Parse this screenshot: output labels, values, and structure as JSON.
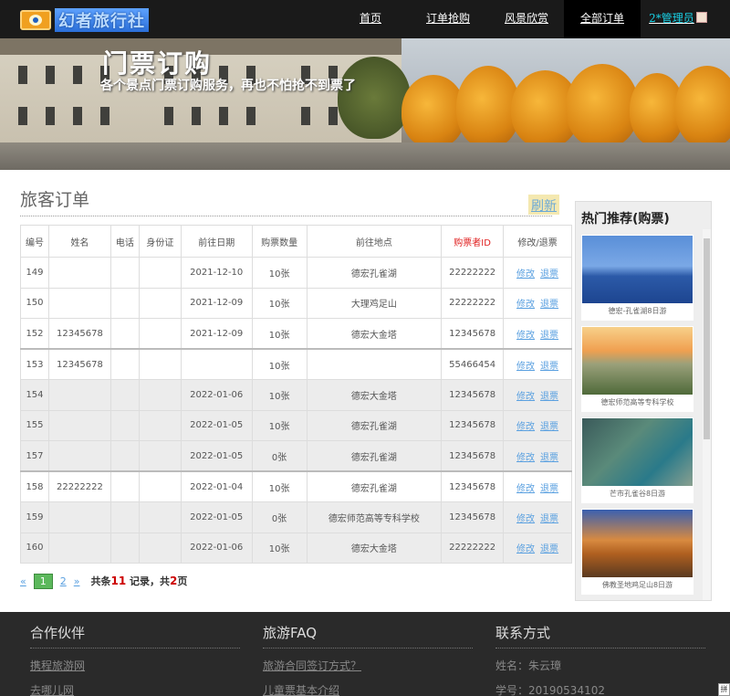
{
  "nav": {
    "logo_text": "幻者旅行社",
    "items": [
      {
        "label": "首页"
      },
      {
        "label": "订单抢购"
      },
      {
        "label": "风景欣赏"
      },
      {
        "label": "全部订单"
      }
    ],
    "admin_label": "2*管理员"
  },
  "banner": {
    "title": "门票订购",
    "subtitle": "各个景点门票订购服务，再也不怕抢不到票了"
  },
  "main": {
    "page_title": "旅客订单",
    "refresh_label": "刷新",
    "table": {
      "headers": [
        "编号",
        "姓名",
        "电话",
        "身份证",
        "前往日期",
        "购票数量",
        "前往地点",
        "购票者ID",
        "修改/退票"
      ],
      "edit_label": "修改",
      "refund_label": "退票",
      "rows": [
        {
          "id": "149",
          "name": "",
          "phone": "",
          "idcard": "",
          "date": "2021-12-10",
          "qty": "10张",
          "place": "德宏孔雀湖",
          "uid": "22222222"
        },
        {
          "id": "150",
          "name": "",
          "phone": "",
          "idcard": "",
          "date": "2021-12-09",
          "qty": "10张",
          "place": "大理鸡足山",
          "uid": "22222222"
        },
        {
          "id": "152",
          "name": "12345678",
          "phone": "",
          "idcard": "",
          "date": "2021-12-09",
          "qty": "10张",
          "place": "德宏大金塔",
          "uid": "12345678"
        },
        {
          "id": "153",
          "name": "12345678",
          "phone": "",
          "idcard": "",
          "date": "",
          "qty": "10张",
          "place": "",
          "uid": "55466454"
        },
        {
          "id": "154",
          "name": "",
          "phone": "",
          "idcard": "",
          "date": "2022-01-06",
          "qty": "10张",
          "place": "德宏大金塔",
          "uid": "12345678"
        },
        {
          "id": "155",
          "name": "",
          "phone": "",
          "idcard": "",
          "date": "2022-01-05",
          "qty": "10张",
          "place": "德宏孔雀湖",
          "uid": "12345678"
        },
        {
          "id": "157",
          "name": "",
          "phone": "",
          "idcard": "",
          "date": "2022-01-05",
          "qty": "0张",
          "place": "德宏孔雀湖",
          "uid": "12345678"
        },
        {
          "id": "158",
          "name": "22222222",
          "phone": "",
          "idcard": "",
          "date": "2022-01-04",
          "qty": "10张",
          "place": "德宏孔雀湖",
          "uid": "12345678"
        },
        {
          "id": "159",
          "name": "",
          "phone": "",
          "idcard": "",
          "date": "2022-01-05",
          "qty": "0张",
          "place": "德宏师范高等专科学校",
          "uid": "12345678"
        },
        {
          "id": "160",
          "name": "",
          "phone": "",
          "idcard": "",
          "date": "2022-01-06",
          "qty": "10张",
          "place": "德宏大金塔",
          "uid": "22222222"
        }
      ]
    },
    "pager": {
      "prev": "«",
      "pages": [
        "1",
        "2"
      ],
      "current": "1",
      "next": "»",
      "summary_prefix": "共条",
      "total_records": "11",
      "summary_mid": "记录，共",
      "total_pages": "2",
      "summary_suffix": "页"
    }
  },
  "sidebar": {
    "title": "热门推荐(购票)",
    "cards": [
      {
        "caption": "德宏-孔雀湖8日游",
        "image": "lake-photo"
      },
      {
        "caption": "德宏师范高等专科学校",
        "image": "campus-photo"
      },
      {
        "caption": "芒市孔雀谷8日游",
        "image": "peacock-photo"
      },
      {
        "caption": "佛教圣地鸡足山8日游",
        "image": "temple-photo"
      }
    ]
  },
  "footer": {
    "partners": {
      "title": "合作伙伴",
      "links": [
        "携程旅游网",
        "去哪儿网"
      ]
    },
    "faq": {
      "title": "旅游FAQ",
      "links": [
        "旅游合同签订方式？",
        "儿童票基本介绍"
      ]
    },
    "contact": {
      "title": "联系方式",
      "lines": [
        "姓名：朱云璋",
        "学号：20190534102"
      ]
    }
  },
  "ime_indicator": "拼"
}
